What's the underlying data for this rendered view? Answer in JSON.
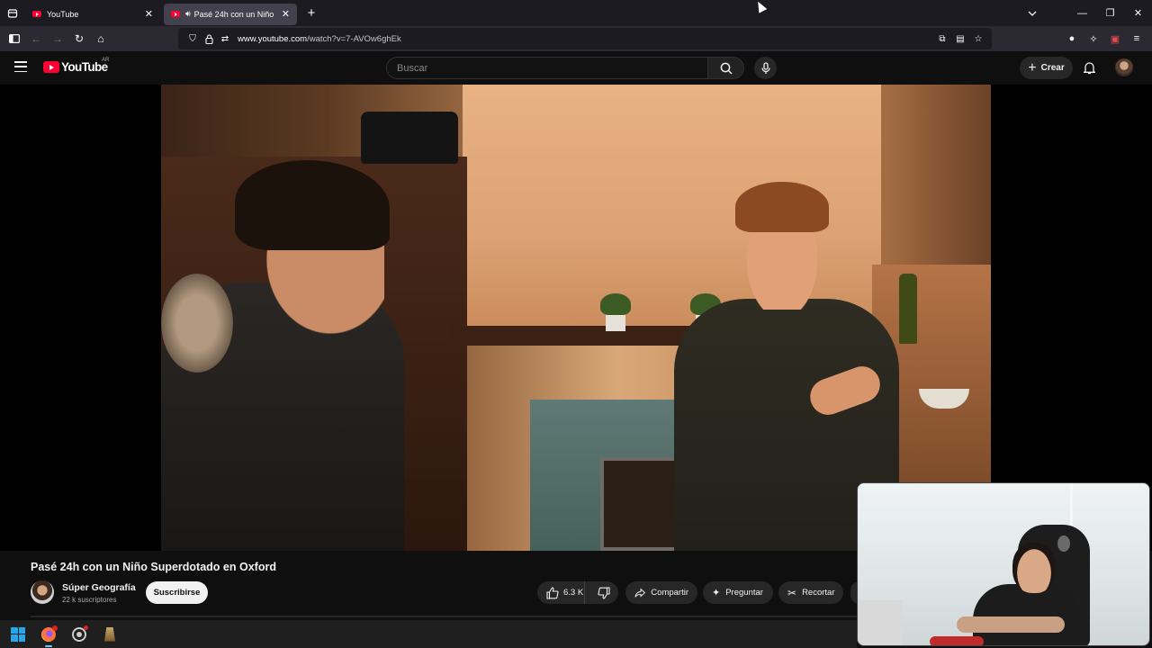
{
  "browser": {
    "tabs": [
      {
        "title": "YouTube",
        "active": false
      },
      {
        "title": "Pasé 24h con un Niño Superdotado en Oxford",
        "active": true
      }
    ],
    "url_host": "www.youtube.com",
    "url_path": "/watch?v=7-AVOw6ghEk"
  },
  "youtube": {
    "logo_text": "YouTube",
    "country_code": "AR",
    "search_placeholder": "Buscar",
    "create_label": "Crear"
  },
  "video": {
    "title": "Pasé 24h con un Niño Superdotado en Oxford",
    "channel_name": "Súper Geografía",
    "subscribers": "22 k suscriptores",
    "subscribe_label": "Suscribirse",
    "likes": "6.3 K",
    "share_label": "Compartir",
    "ask_label": "Preguntar",
    "clip_label": "Recortar"
  },
  "colors": {
    "brand_red": "#ff0033",
    "page_bg": "#0f0f0f",
    "pill_bg": "#272727"
  },
  "icons": [
    "tab-list-icon",
    "youtube-favicon",
    "speaker-icon",
    "close-icon",
    "new-tab-icon",
    "chevron-down-icon",
    "minimize-icon",
    "restore-icon",
    "sidebar-icon",
    "back-icon",
    "forward-icon",
    "reload-icon",
    "home-icon",
    "shield-icon",
    "lock-icon",
    "permissions-icon",
    "picture-in-picture-icon",
    "reader-icon",
    "bookmark-star-icon",
    "account-icon",
    "extensions-icon",
    "calendar-extension-icon",
    "menu-icon",
    "hamburger-icon",
    "search-icon",
    "microphone-icon",
    "plus-icon",
    "bell-icon",
    "thumbs-up-icon",
    "thumbs-down-icon",
    "share-icon",
    "sparkle-icon",
    "scissors-icon",
    "windows-start-icon",
    "firefox-icon",
    "chrome-icon",
    "league-icon"
  ]
}
